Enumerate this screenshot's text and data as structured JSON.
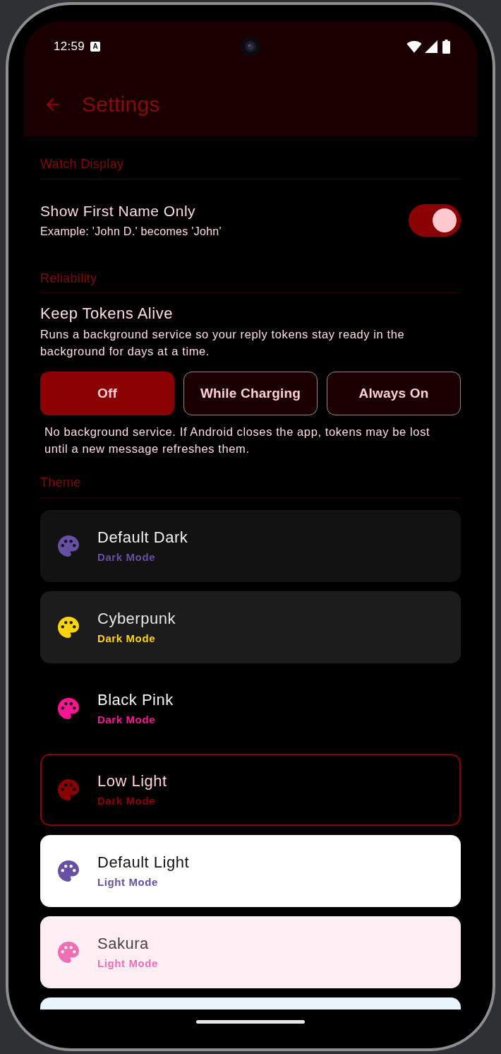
{
  "status_bar": {
    "time": "12:59",
    "notification_badge": "A"
  },
  "app_bar": {
    "title": "Settings"
  },
  "watch_display": {
    "heading": "Watch Display",
    "setting": {
      "title": "Show First Name Only",
      "subtitle": "Example: 'John D.' becomes 'John'",
      "on": true
    }
  },
  "reliability": {
    "heading": "Reliability",
    "title": "Keep Tokens Alive",
    "description": "Runs a background service so your reply tokens stay ready in the background for days at a time.",
    "options": [
      {
        "label": "Off",
        "selected": true
      },
      {
        "label": "While Charging",
        "selected": false
      },
      {
        "label": "Always On",
        "selected": false
      }
    ],
    "help": "No background service. If Android closes the app, tokens may be lost until a new message refreshes them."
  },
  "theme": {
    "heading": "Theme",
    "themes": [
      {
        "kind": "charcoal",
        "name": "Default Dark",
        "mode": "Dark Mode",
        "color": "#6750a4",
        "selected": false
      },
      {
        "kind": "graphite",
        "name": "Cyberpunk",
        "mode": "Dark Mode",
        "color": "#ffd400",
        "selected": false
      },
      {
        "kind": "black",
        "name": "Black Pink",
        "mode": "Dark Mode",
        "color": "#ff1493",
        "selected": false
      },
      {
        "kind": "crimson",
        "name": "Low Light",
        "mode": "Dark Mode",
        "color": "#8b0000",
        "selected": true
      },
      {
        "kind": "white",
        "name": "Default Light",
        "mode": "Light Mode",
        "color": "#6750a4",
        "selected": false
      },
      {
        "kind": "blush",
        "name": "Sakura",
        "mode": "Light Mode",
        "color": "#f06eb4",
        "selected": false
      },
      {
        "kind": "ice",
        "cut_off": true,
        "selected": false
      }
    ]
  }
}
